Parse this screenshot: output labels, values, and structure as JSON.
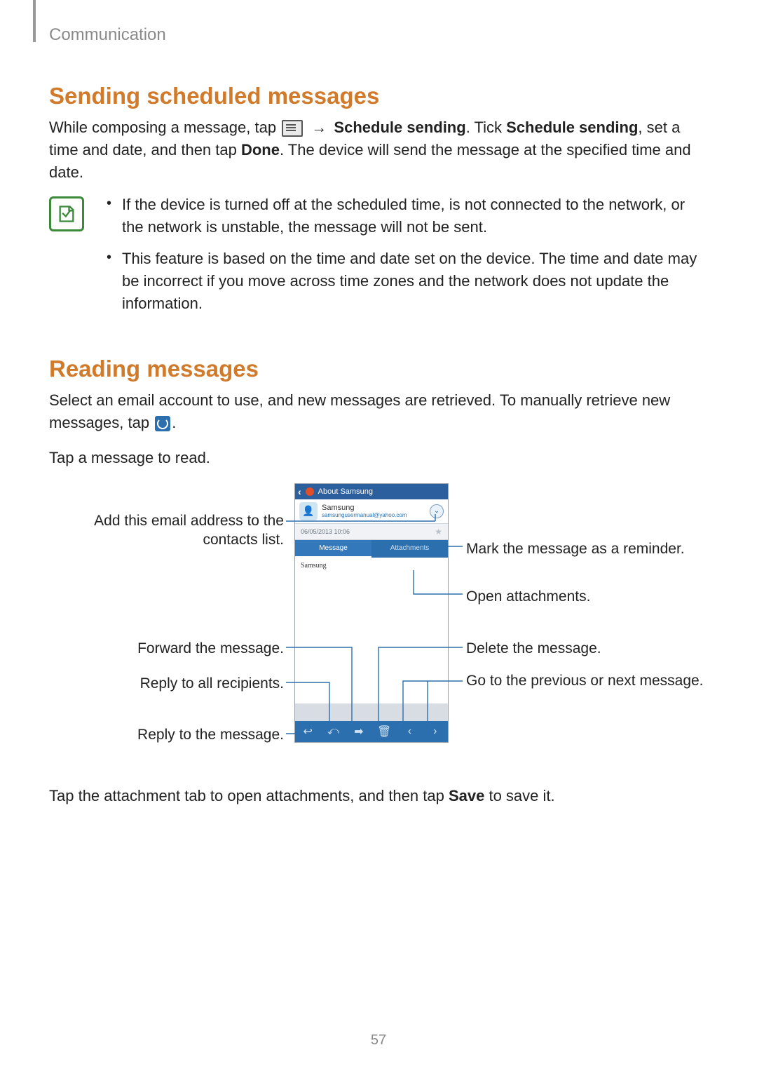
{
  "breadcrumb": "Communication",
  "page_number": "57",
  "section1": {
    "title": "Sending scheduled messages",
    "para_parts": {
      "p1": "While composing a message, tap ",
      "arrow": "→",
      "schedule_sending": "Schedule sending",
      "p2": ". Tick ",
      "schedule_sending2": "Schedule sending",
      "p3": ", set a time and date, and then tap ",
      "done": "Done",
      "p4": ". The device will send the message at the specified time and date."
    },
    "notes": [
      "If the device is turned off at the scheduled time, is not connected to the network, or the network is unstable, the message will not be sent.",
      "This feature is based on the time and date set on the device. The time and date may be incorrect if you move across time zones and the network does not update the information."
    ]
  },
  "section2": {
    "title": "Reading messages",
    "para1_parts": {
      "p1": "Select an email account to use, and new messages are retrieved. To manually retrieve new messages, tap ",
      "p2": "."
    },
    "para2": "Tap a message to read.",
    "para3_parts": {
      "p1": "Tap the attachment tab to open attachments, and then tap ",
      "save": "Save",
      "p2": " to save it."
    }
  },
  "screenshot": {
    "title": "About Samsung",
    "sender_name": "Samsung",
    "sender_email": "samsungusermanual@yahoo.com",
    "date": "06/05/2013  10:06",
    "tab_message": "Message",
    "tab_attachments": "Attachments",
    "body": "Samsung"
  },
  "callouts": {
    "add_contact": "Add this email address to the contacts list.",
    "mark_reminder": "Mark the message as a reminder.",
    "open_attachments": "Open attachments.",
    "forward": "Forward the message.",
    "delete": "Delete the message.",
    "reply_all": "Reply to all recipients.",
    "prev_next": "Go to the previous or next message.",
    "reply": "Reply to the message."
  }
}
